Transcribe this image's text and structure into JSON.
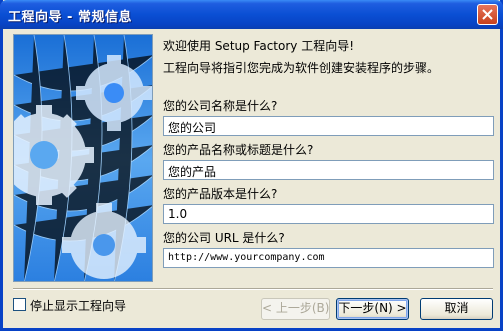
{
  "window": {
    "title": "工程向导 - 常规信息"
  },
  "content": {
    "heading": "欢迎使用 Setup Factory 工程向导!",
    "intro": "工程向导将指引您完成为软件创建安装程序的步骤。",
    "company_label": "您的公司名称是什么?",
    "company_value": "您的公司",
    "product_label": "您的产品名称或标题是什么?",
    "product_value": "您的产品",
    "version_label": "您的产品版本是什么?",
    "version_value": "1.0",
    "url_label": "您的公司 URL 是什么?",
    "url_value": "http://www.yourcompany.com"
  },
  "footer": {
    "stop_wizard_label": "停止显示工程向导",
    "back_button": "< 上一步(B)",
    "next_button": "下一步(N) >",
    "cancel_button": "取消"
  },
  "colors": {
    "titlebar": "#0a4fd4",
    "dialog_bg": "#ece9d8",
    "banner_sky": "#1a6fd6"
  }
}
